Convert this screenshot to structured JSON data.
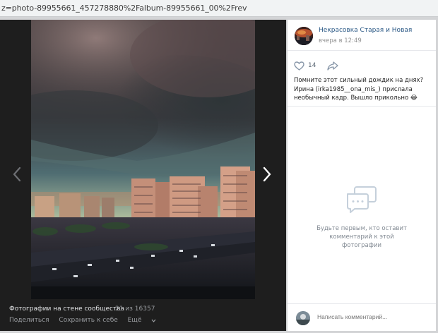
{
  "address_bar": {
    "url": "z=photo-89955661_457278880%2Falbum-89955661_00%2Frev"
  },
  "photo_footer": {
    "album_title": "Фотографии на стене сообщества",
    "album_count": "21 из 16357",
    "share_label": "Поделиться",
    "save_label": "Сохранить к себе",
    "more_label": "Ещё"
  },
  "post": {
    "author_name": "Некрасовка Старая и Новая",
    "date": "вчера в 12:49",
    "like_count": "14",
    "text": "Помните этот сильный дождик на днях? Ирина (irka1985__ona_mis_) прислала необычный кадр. Вышло прикольно 😂"
  },
  "comments": {
    "empty_text": "Будьте первым, кто оставит комментарий к этой фотографии",
    "input_placeholder": "Написать комментарий..."
  },
  "icons": {
    "prev": "chevron-left-icon",
    "next": "chevron-right-icon",
    "like": "heart-icon",
    "share": "share-arrow-icon",
    "empty": "comments-bubble-icon"
  },
  "colors": {
    "link": "#2a5885",
    "dark_panel": "#1e1e1e",
    "accent_blue": "#5181b8"
  }
}
